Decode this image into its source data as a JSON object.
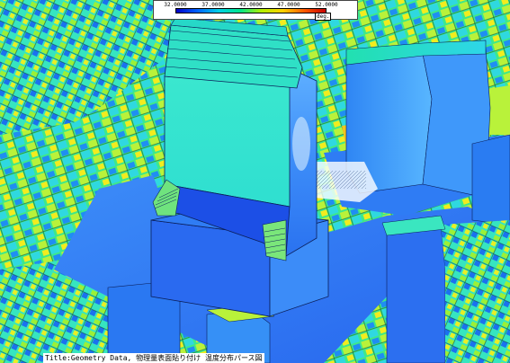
{
  "legend": {
    "ticks": [
      "32.0000",
      "37.0000",
      "42.0000",
      "47.0000",
      "52.0000"
    ],
    "unit": "deg.",
    "colors": [
      "#0000c8",
      "#0064ff",
      "#00d2e6",
      "#00e68c",
      "#b4f000",
      "#ffd200",
      "#ff5a00",
      "#c80000"
    ]
  },
  "title": "Title:Geometry Data, 物理量表面貼り付け 温度分布パース図",
  "palette": {
    "ground_blue": "#2e6ff0",
    "deep_blue": "#1030d8",
    "mid_blue": "#3c8cf8",
    "cyan": "#1ee6d2",
    "green": "#3cf07a",
    "lime": "#b9f23a",
    "yellow": "#f2ec1e",
    "orange": "#f7a21a",
    "facade": "#34e6cf"
  }
}
